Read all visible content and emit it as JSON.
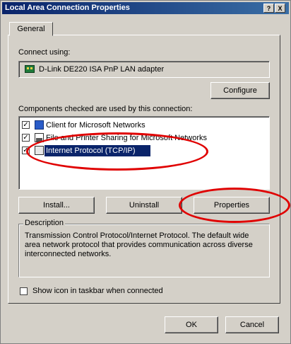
{
  "window": {
    "title": "Local Area Connection Properties",
    "help_glyph": "?",
    "close_glyph": "X"
  },
  "tabs": [
    {
      "label": "General",
      "selected": true
    }
  ],
  "connect": {
    "label": "Connect using:",
    "adapter_name": "D-Link DE220 ISA PnP LAN adapter",
    "configure_label": "Configure"
  },
  "components": {
    "label": "Components checked are used by this connection:",
    "items": [
      {
        "label": "Client for Microsoft Networks",
        "checked": true,
        "selected": false
      },
      {
        "label": "File and Printer Sharing for Microsoft Networks",
        "checked": true,
        "selected": false
      },
      {
        "label": "Internet Protocol (TCP/IP)",
        "checked": true,
        "selected": true
      }
    ]
  },
  "buttons": {
    "install": "Install...",
    "uninstall": "Uninstall",
    "properties": "Properties"
  },
  "description": {
    "legend": "Description",
    "text": "Transmission Control Protocol/Internet Protocol. The default wide area network protocol that provides communication across diverse interconnected networks."
  },
  "taskbar_option": {
    "label": "Show icon in taskbar when connected",
    "checked": false
  },
  "footer": {
    "ok": "OK",
    "cancel": "Cancel"
  },
  "colors": {
    "titlebar": "#0a246a",
    "selection": "#0a246a",
    "highlight_ellipse": "#e00000"
  }
}
